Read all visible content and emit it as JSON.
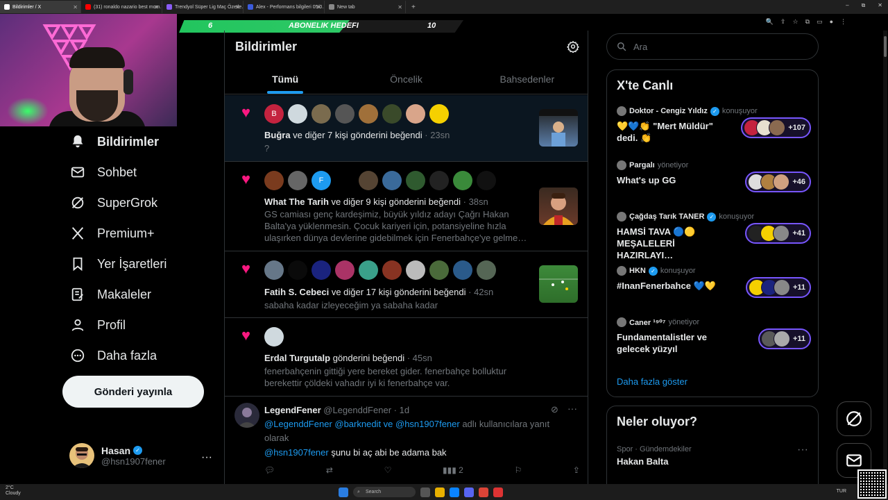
{
  "browser": {
    "tabs": [
      {
        "title": "Bildirimler / X",
        "color": "#ffffff",
        "active": true
      },
      {
        "title": "(31) ronaldo nazario best mom…",
        "color": "#ff0000"
      },
      {
        "title": "Trendyol Süper Lig Maç Özetle…",
        "color": "#8a5cf6"
      },
      {
        "title": "Alex - Performans bilgileri 05/0…",
        "color": "#3b5bdb"
      },
      {
        "title": "New tab",
        "color": "#888888"
      }
    ],
    "new_tab": "+",
    "window_controls": [
      "–",
      "⧉",
      "✕"
    ]
  },
  "subscription_goal": {
    "current": "6",
    "label": "ABONELIK HEDEFI",
    "target": "10",
    "progress": 0.6
  },
  "nav": {
    "items": [
      {
        "label": "Bildirimler",
        "icon": "bell-icon",
        "active": true
      },
      {
        "label": "Sohbet",
        "icon": "mail-icon"
      },
      {
        "label": "SuperGrok",
        "icon": "grok-icon"
      },
      {
        "label": "Premium+",
        "icon": "x-logo-icon"
      },
      {
        "label": "Yer İşaretleri",
        "icon": "bookmark-icon"
      },
      {
        "label": "Makaleler",
        "icon": "article-icon"
      },
      {
        "label": "Profil",
        "icon": "person-icon"
      },
      {
        "label": "Daha fazla",
        "icon": "more-circle-icon"
      }
    ],
    "post_button": "Gönderi yayınla",
    "account": {
      "name": "Hasan",
      "handle": "@hsn1907fener",
      "more": "···"
    }
  },
  "main": {
    "title": "Bildirimler",
    "tabs": [
      "Tümü",
      "Öncelik",
      "Bahsedenler"
    ],
    "notifications": [
      {
        "avatars": [
          "B",
          "",
          "",
          "",
          "",
          "",
          "",
          ""
        ],
        "avatar_colors": [
          "#c4233f",
          "#cfd9de",
          "#7a6b4e",
          "#555555",
          "#a0703a",
          "#3a4a2a",
          "#d9a58a",
          "#f5d000"
        ],
        "actor": "Buğra",
        "action": " ve diğer 7 kişi gönderini beğendi",
        "time": " · 23sn",
        "text": "?"
      },
      {
        "avatars": [
          "",
          "",
          "F",
          "",
          "",
          "",
          "",
          "",
          "",
          ""
        ],
        "avatar_colors": [
          "#7a3b1e",
          "#666666",
          "#1d9bf0",
          "#000000",
          "#554433",
          "#3a6a9a",
          "#2f5a2f",
          "#222222",
          "#3a8a3a",
          "#111111"
        ],
        "actor": "What The Tarih",
        "action": " ve diğer 9 kişi gönderini beğendi",
        "time": " · 38sn",
        "text": "GS camiası genç kardeşimiz, büyük yıldız adayı Çağrı Hakan Balta'ya yüklenmesin. Çocuk kariyeri için, potansiyeline hızla ulaşırken dünya devlerine gidebilmek için Fenerbahçe'ye gelme…"
      },
      {
        "avatars": [
          "",
          "",
          "",
          "",
          "",
          "",
          "",
          "",
          "",
          ""
        ],
        "avatar_colors": [
          "#667788",
          "#0a0a0a",
          "#1a237e",
          "#aa3366",
          "#3aa08a",
          "#883322",
          "#bbbbbb",
          "#4a6a3a",
          "#2a5a8a",
          "#556655"
        ],
        "actor": "Fatih S. Cebeci",
        "action": " ve diğer 17 kişi gönderini beğendi",
        "time": " · 42sn",
        "text": "sabaha kadar izleyeceğim ya sabaha kadar"
      },
      {
        "avatars": [
          ""
        ],
        "avatar_colors": [
          "#cfd9de"
        ],
        "actor": "Erdal Turgutalp",
        "action": " gönderini beğendi",
        "time": " · 45sn",
        "text": "fenerbahçenin gittiği yere bereket gider. fenerbahçe bolluktur berekettir çöldeki vahadır iyi ki fenerbahçe var."
      }
    ],
    "tweet": {
      "name": "LegendFener",
      "handle": "@LegenddFener",
      "time": "· 1d",
      "reply_mentions": "@LegenddFener @barknedit ve @hsn1907fener",
      "reply_suffix": " adlı kullanıcılara yanıt",
      "reply_suffix2": "olarak",
      "mention": "@hsn1907fener",
      "text": "  şunu bi aç abi be adama bak",
      "views": "2"
    }
  },
  "right": {
    "search_placeholder": "Ara",
    "live_title": "X'te Canlı",
    "live": [
      {
        "host": "Doktor - Cengiz Yıldız",
        "verified": true,
        "role": "konuşuyor",
        "title": "💛💙👏 \"Mert Müldür\" dedi. 👏",
        "count": "+107"
      },
      {
        "host": "Pargalı",
        "verified": false,
        "role": "yönetiyor",
        "title": "What's up GG",
        "count": "+46"
      },
      {
        "host": "Çağdaş Tarık TANER",
        "verified": true,
        "role": "konuşuyor",
        "title": "HAMSİ TAVA 🔵🟡 MEŞALELERİ HAZIRLAYI…",
        "count": "+41"
      },
      {
        "host": "HKN",
        "verified": true,
        "role": "konuşuyor",
        "title": "#InanFenerbahce 💙💛",
        "count": "+11"
      },
      {
        "host": "Caner ¹⁹⁰⁷",
        "verified": false,
        "role": "yönetiyor",
        "title": "Fundamentalistler ve gelecek yüzyıl",
        "count": "+11"
      }
    ],
    "show_more": "Daha fazla göster",
    "happening_title": "Neler oluyor?",
    "trend_category": "Spor · Gündemdekiler",
    "trend_topic": "Hakan Balta",
    "trend_more": "···"
  },
  "taskbar": {
    "temp": "2°C",
    "weather": "Cloudy",
    "search": "Search",
    "lang": "TUR"
  },
  "colors": {
    "accent": "#1d9bf0",
    "like": "#f91880",
    "live_border": "#7856ff",
    "goal": "#22c55e"
  }
}
